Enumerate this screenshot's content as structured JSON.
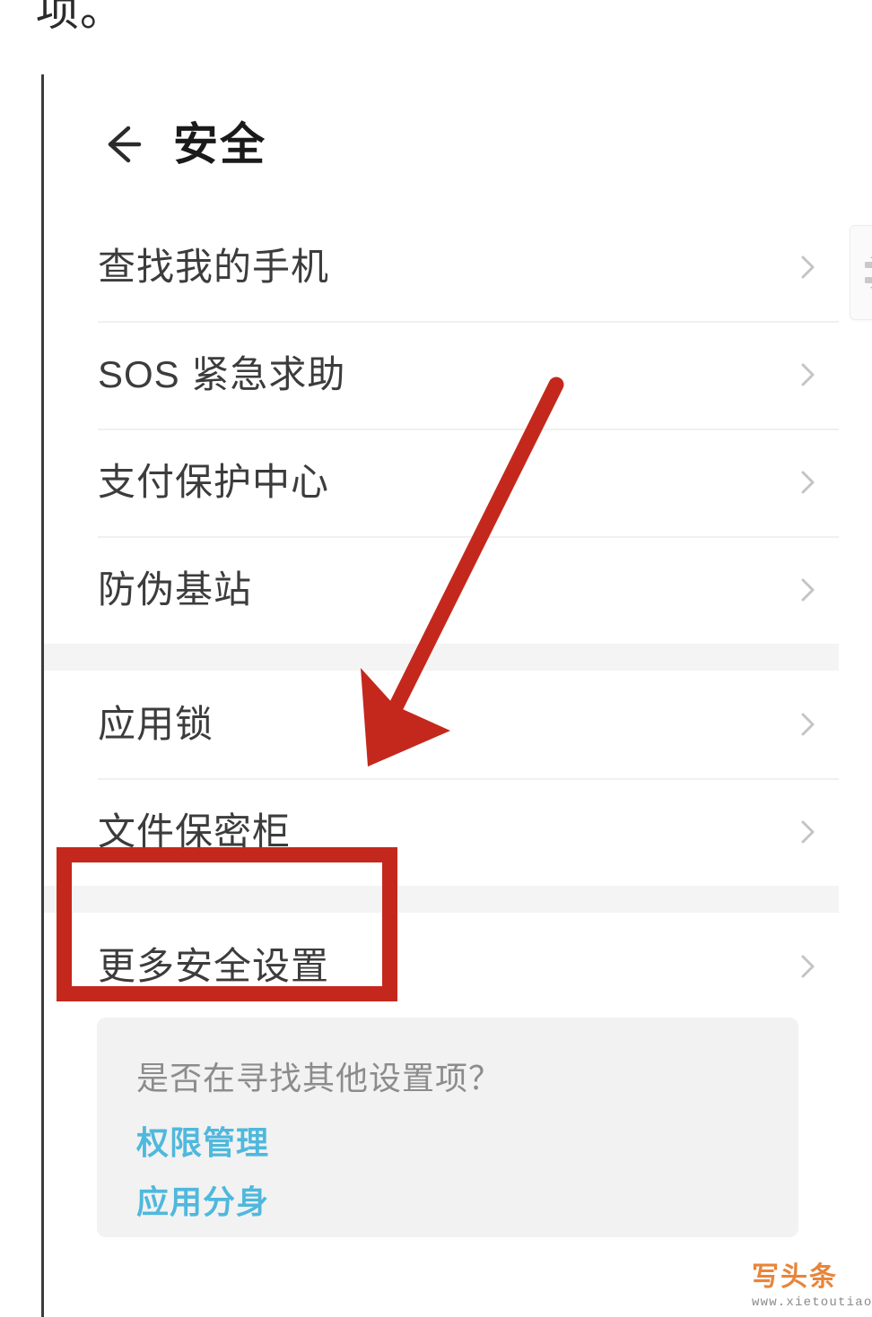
{
  "article": {
    "partial_text": "项。"
  },
  "phone": {
    "header": {
      "back_icon": "back-arrow-icon",
      "title": "安全"
    },
    "scroll_chip": {
      "up_icon": "triangle-up-icon",
      "down_icon": "triangle-down-icon"
    },
    "groups": [
      {
        "rows": [
          {
            "label": "查找我的手机",
            "chevron": "chevron-right-icon"
          },
          {
            "label": "SOS 紧急求助",
            "chevron": "chevron-right-icon"
          },
          {
            "label": "支付保护中心",
            "chevron": "chevron-right-icon"
          },
          {
            "label": "防伪基站",
            "chevron": "chevron-right-icon"
          }
        ]
      },
      {
        "rows": [
          {
            "label": "应用锁",
            "chevron": "chevron-right-icon"
          },
          {
            "label": "文件保密柜",
            "chevron": "chevron-right-icon"
          }
        ]
      },
      {
        "rows": [
          {
            "label": "更多安全设置",
            "chevron": "chevron-right-icon"
          }
        ]
      }
    ],
    "hint_card": {
      "title": "是否在寻找其他设置项？",
      "links": [
        "权限管理",
        "应用分身"
      ]
    }
  },
  "annotations": {
    "highlight_color": "#c4281c",
    "arrow_color": "#c4281c",
    "highlight_target": "更多安全设置",
    "arrow_points_to": "文件保密柜"
  },
  "watermark": {
    "logo_text": "写头条",
    "url": "www.xietoutiao.com",
    "logo_color": "#e8853a"
  }
}
